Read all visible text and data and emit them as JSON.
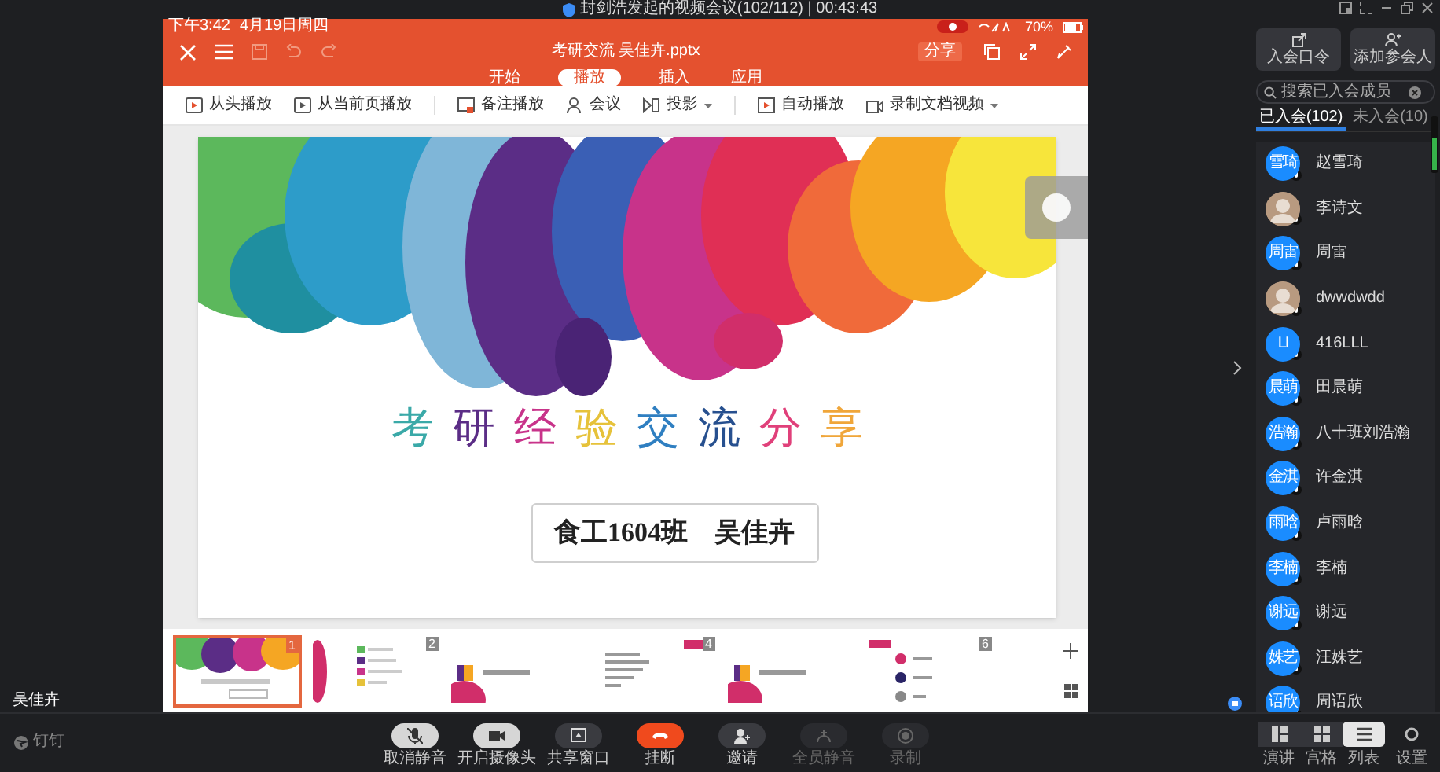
{
  "window": {
    "title": "封剑浩发起的视频会议(102/112) | 00:43:43"
  },
  "shared_screen": {
    "status_bar": {
      "time": "下午3:42",
      "date": "4月19日周四",
      "battery": "70%"
    },
    "toolbar": {
      "file_name": "考研交流 吴佳卉.pptx",
      "share_button": "分享"
    },
    "tabs": [
      {
        "label": "开始",
        "selected": false
      },
      {
        "label": "播放",
        "selected": true
      },
      {
        "label": "插入",
        "selected": false
      },
      {
        "label": "应用",
        "selected": false
      }
    ],
    "ribbon": [
      {
        "label": "从头播放",
        "dropdown": false,
        "separator_before": false
      },
      {
        "label": "从当前页播放",
        "dropdown": false,
        "separator_before": false
      },
      {
        "label": "备注播放",
        "dropdown": false,
        "separator_before": true
      },
      {
        "label": "会议",
        "dropdown": false,
        "separator_before": false
      },
      {
        "label": "投影",
        "dropdown": true,
        "separator_before": false
      },
      {
        "label": "自动播放",
        "dropdown": false,
        "separator_before": true
      },
      {
        "label": "录制文档视频",
        "dropdown": true,
        "separator_before": false
      }
    ],
    "slide": {
      "title": [
        {
          "text": "考",
          "color": "#3aa9a8"
        },
        {
          "text": "研",
          "color": "#5b2d86"
        },
        {
          "text": "经",
          "color": "#c8338a"
        },
        {
          "text": "验",
          "color": "#e6c23a"
        },
        {
          "text": "交",
          "color": "#2f7fc1"
        },
        {
          "text": "流",
          "color": "#27508f"
        },
        {
          "text": "分",
          "color": "#e0407a"
        },
        {
          "text": "享",
          "color": "#f0a63a"
        }
      ],
      "subtitle": "食工1604班　吴佳卉"
    },
    "thumbnails": [
      {
        "number": "1",
        "kind": "cover",
        "selected": true
      },
      {
        "number": "2",
        "kind": "agenda",
        "selected": false
      },
      {
        "kind": "section",
        "selected": false
      },
      {
        "number": "4",
        "kind": "details",
        "selected": false
      },
      {
        "kind": "section",
        "selected": false
      },
      {
        "number": "6",
        "kind": "legend",
        "selected": false
      }
    ]
  },
  "presenter_name": "吴佳卉",
  "sidebar": {
    "buttons": [
      "入会口令",
      "添加参会人"
    ],
    "search": {
      "placeholder": "搜索已入会成员"
    },
    "tabs": [
      {
        "label": "已入会(102)",
        "selected": true
      },
      {
        "label": "未入会(10)",
        "selected": false
      }
    ],
    "participants": [
      {
        "name": "赵雪琦",
        "kind": "initials",
        "initials": "雪琦"
      },
      {
        "name": "李诗文"
      },
      {
        "name": "周雷",
        "kind": "initials",
        "initials": "周雷"
      },
      {
        "name": "dwwdwdd"
      },
      {
        "name": "416LLL",
        "kind": "initials",
        "initials": "LI"
      },
      {
        "name": "田晨萌",
        "kind": "initials",
        "initials": "晨萌"
      },
      {
        "name": "八十班刘浩瀚",
        "kind": "initials",
        "initials": "浩瀚"
      },
      {
        "name": "许金淇",
        "kind": "initials",
        "initials": "金淇"
      },
      {
        "name": "卢雨晗",
        "kind": "initials",
        "initials": "雨晗"
      },
      {
        "name": "李楠",
        "kind": "initials",
        "initials": "李楠"
      },
      {
        "name": "谢远",
        "kind": "initials",
        "initials": "谢远"
      },
      {
        "name": "汪姝艺",
        "kind": "initials",
        "initials": "姝艺"
      },
      {
        "name": "周语欣",
        "kind": "initials",
        "initials": "语欣"
      }
    ]
  },
  "app_name": "钉钉",
  "controls": [
    {
      "label": "取消静音",
      "kind": "mic",
      "active": true,
      "disabled": false
    },
    {
      "label": "开启摄像头",
      "kind": "camera",
      "active": true,
      "disabled": false
    },
    {
      "label": "共享窗口",
      "kind": "share",
      "active": false,
      "disabled": false
    },
    {
      "label": "挂断",
      "kind": "hangup",
      "active": false,
      "disabled": false
    },
    {
      "label": "邀请",
      "kind": "invite",
      "active": false,
      "disabled": false
    },
    {
      "label": "全员静音",
      "kind": "mute_all",
      "active": false,
      "disabled": true
    },
    {
      "label": "录制",
      "kind": "record",
      "active": false,
      "disabled": true
    }
  ],
  "views": [
    {
      "label": "演讲",
      "selected": false
    },
    {
      "label": "宫格",
      "selected": false
    },
    {
      "label": "列表",
      "selected": true
    }
  ],
  "settings_label": "设置"
}
